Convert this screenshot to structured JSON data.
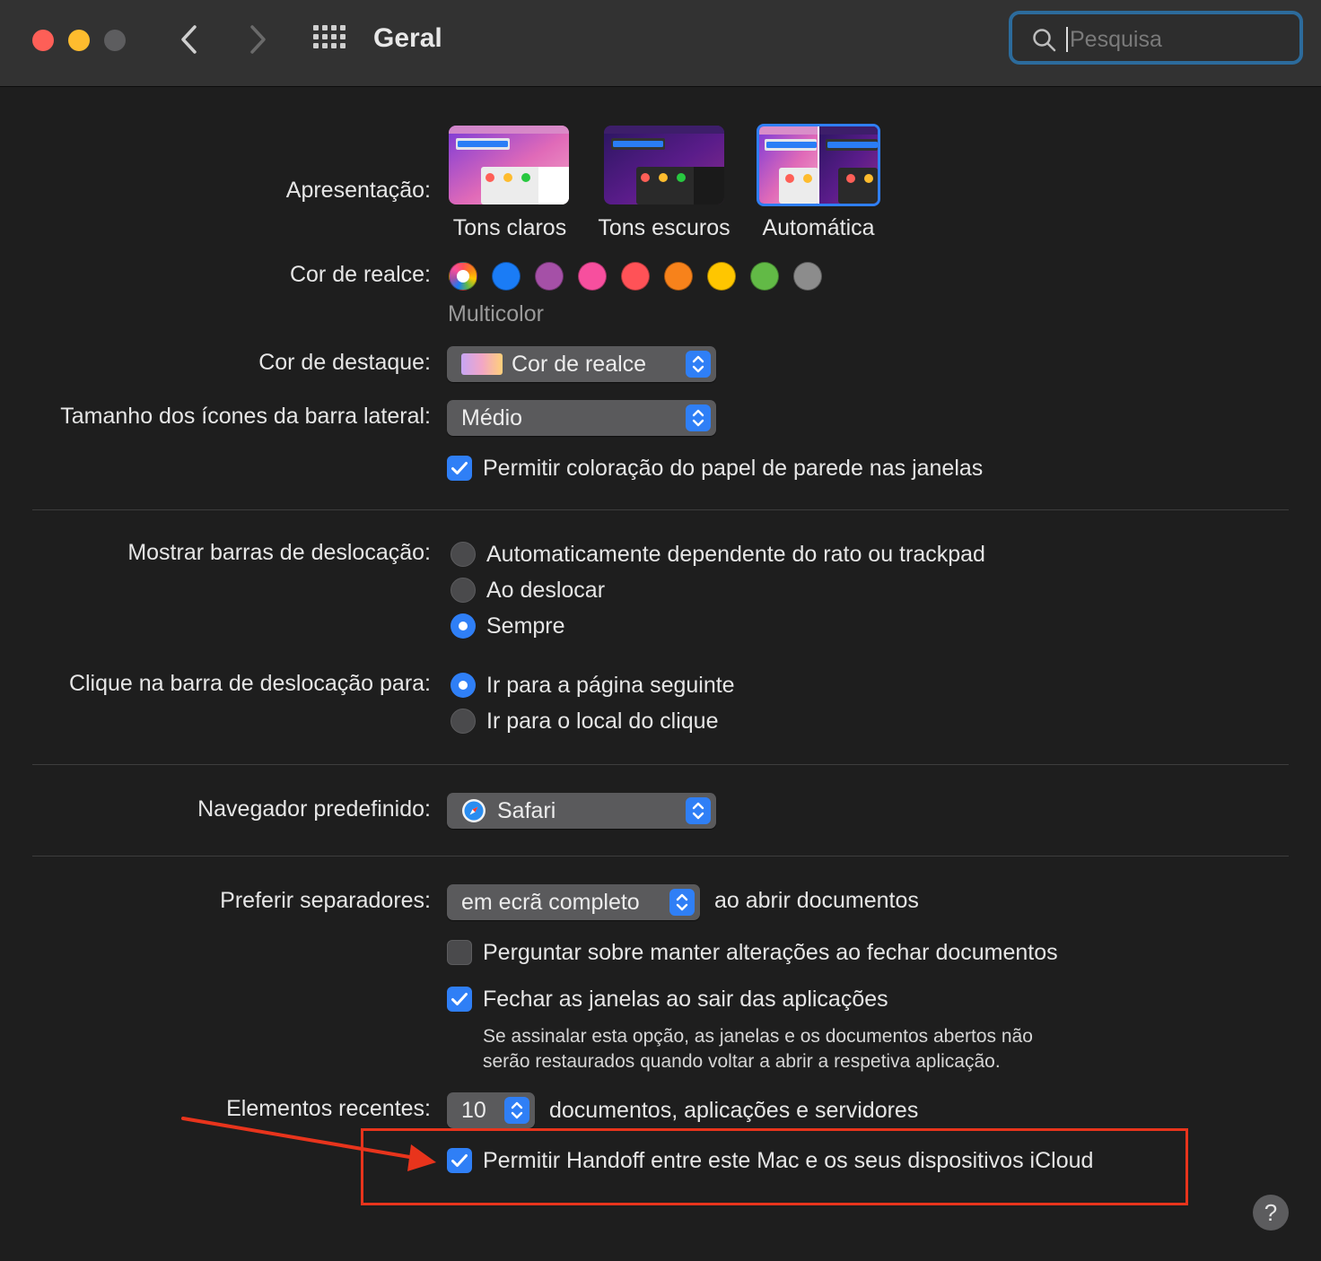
{
  "window": {
    "title": "Geral",
    "search_placeholder": "Pesquisa"
  },
  "appearance": {
    "label": "Apresentação:",
    "options": [
      {
        "label": "Tons claros",
        "selected": false
      },
      {
        "label": "Tons escuros",
        "selected": false
      },
      {
        "label": "Automática",
        "selected": true
      }
    ]
  },
  "accent": {
    "label": "Cor de realce:",
    "selected_name": "Multicolor",
    "colors": [
      "multicolor",
      "#1a7cf6",
      "#a550a7",
      "#f74f9e",
      "#ff5257",
      "#f7821b",
      "#ffc600",
      "#62ba46",
      "#8c8c8c"
    ]
  },
  "highlight": {
    "label": "Cor de destaque:",
    "value": "Cor de realce"
  },
  "sidebar_icons": {
    "label": "Tamanho dos ícones da barra lateral:",
    "value": "Médio"
  },
  "wallpaper_tinting": {
    "label": "Permitir coloração do papel de parede nas janelas",
    "checked": true
  },
  "show_scrollbars": {
    "label": "Mostrar barras de deslocação:",
    "options": [
      {
        "label": "Automaticamente dependente do rato ou trackpad",
        "selected": false
      },
      {
        "label": "Ao deslocar",
        "selected": false
      },
      {
        "label": "Sempre",
        "selected": true
      }
    ]
  },
  "click_scrollbar": {
    "label": "Clique na barra de deslocação para:",
    "options": [
      {
        "label": "Ir para a página seguinte",
        "selected": true
      },
      {
        "label": "Ir para o local do clique",
        "selected": false
      }
    ]
  },
  "browser": {
    "label": "Navegador predefinido:",
    "value": "Safari"
  },
  "tabs": {
    "label": "Preferir separadores:",
    "value": "em ecrã completo",
    "suffix": "ao abrir documentos"
  },
  "ask_keep_changes": {
    "label": "Perguntar sobre manter alterações ao fechar documentos",
    "checked": false
  },
  "close_windows": {
    "label": "Fechar as janelas ao sair das aplicações",
    "checked": true,
    "note_line1": "Se assinalar esta opção, as janelas e os documentos abertos não",
    "note_line2": "serão restaurados quando voltar a abrir a respetiva aplicação."
  },
  "recent_items": {
    "label": "Elementos recentes:",
    "value": "10",
    "suffix": "documentos, aplicações e servidores"
  },
  "handoff": {
    "label": "Permitir Handoff entre este Mac e os seus dispositivos iCloud",
    "checked": true
  },
  "help_label": "?",
  "colors": {
    "accent_blue": "#2f7ff6",
    "annotation_red": "#e8341c"
  }
}
